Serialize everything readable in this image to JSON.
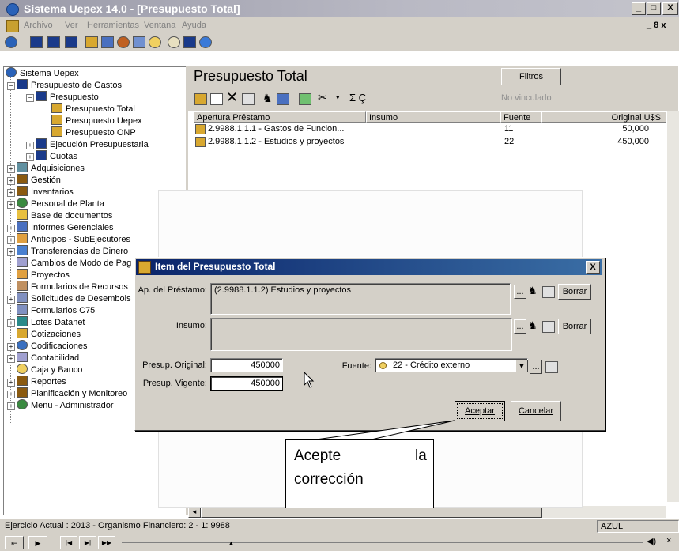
{
  "window": {
    "title": "Sistema Uepex 14.0 - [Presupuesto Total]",
    "min": "_",
    "max": "□",
    "close": "X",
    "mdi_controls": "_ 8 x"
  },
  "menu": [
    "Archivo",
    "Ver",
    "Herramientas",
    "Ventana",
    "Ayuda"
  ],
  "tree": {
    "items": [
      {
        "label": "Sistema Uepex"
      },
      {
        "label": "Presupuesto de Gastos"
      },
      {
        "label": "Presupuesto"
      },
      {
        "label": "Presupuesto Total"
      },
      {
        "label": "Presupuesto Uepex"
      },
      {
        "label": "Presupuesto ONP"
      },
      {
        "label": "Ejecución Presupuestaria"
      },
      {
        "label": "Cuotas"
      },
      {
        "label": "Adquisiciones"
      },
      {
        "label": "Gestión"
      },
      {
        "label": "Inventarios"
      },
      {
        "label": "Personal de Planta"
      },
      {
        "label": "Base de documentos"
      },
      {
        "label": "Informes Gerenciales"
      },
      {
        "label": "Anticipos - SubEjecutores"
      },
      {
        "label": "Transferencias de Dinero"
      },
      {
        "label": "Cambios de Modo de Pag"
      },
      {
        "label": "Proyectos"
      },
      {
        "label": "Formularios de Recursos"
      },
      {
        "label": "Solicitudes de Desembols"
      },
      {
        "label": "Formularios C75"
      },
      {
        "label": "Lotes Datanet"
      },
      {
        "label": "Cotizaciones"
      },
      {
        "label": "Codificaciones"
      },
      {
        "label": "Contabilidad"
      },
      {
        "label": "Caja y Banco"
      },
      {
        "label": "Reportes"
      },
      {
        "label": "Planificación y Monitoreo"
      },
      {
        "label": "Menu - Administrador"
      }
    ]
  },
  "main": {
    "heading": "Presupuesto Total",
    "filters_button": "Filtros",
    "no_vinculado": "No vinculado",
    "toolbar_extra": "Σ Ç",
    "columns": [
      "Apertura Préstamo",
      "Insumo",
      "Fuente",
      "Original U$S"
    ],
    "rows": [
      {
        "apertura": "2.9988.1.1.1  -  Gastos de Funcion...",
        "insumo": "",
        "fuente": "11",
        "original": "50,000"
      },
      {
        "apertura": "2.9988.1.1.2  -  Estudios y proyectos",
        "insumo": "",
        "fuente": "22",
        "original": "450,000"
      }
    ]
  },
  "dialog": {
    "title": "Item del Presupuesto Total",
    "close": "X",
    "prestamo_label": "Ap. del Préstamo:",
    "prestamo_value": "(2.9988.1.1.2) Estudios y proyectos",
    "insumo_label": "Insumo:",
    "insumo_value": "",
    "ellipsis": "...",
    "borrar": "Borrar",
    "presup_original_label": "Presup. Original:",
    "presup_original_value": "450000",
    "presup_vigente_label": "Presup. Vigente:",
    "presup_vigente_value": "450000",
    "fuente_label": "Fuente:",
    "fuente_value": "22 - Crédito externo",
    "aceptar": "Aceptar",
    "cancelar": "Cancelar"
  },
  "callout": {
    "line1_word1": "Acepte",
    "line1_word2": "la",
    "line2": "corrección"
  },
  "status": {
    "text": "Ejercicio Actual : 2013 - Organismo Financiero: 2 - 1: 9988",
    "right": "AZUL"
  }
}
